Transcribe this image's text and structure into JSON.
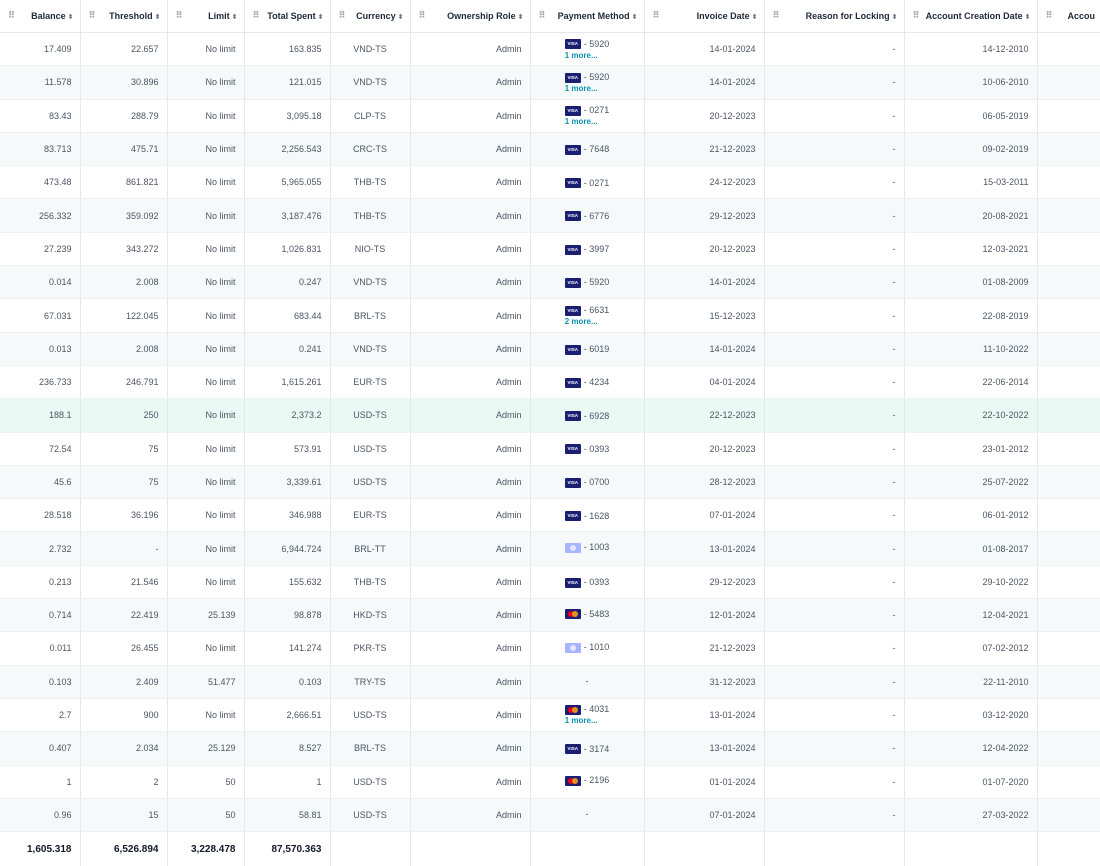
{
  "columns": [
    {
      "key": "balance",
      "label": "Balance"
    },
    {
      "key": "threshold",
      "label": "Threshold"
    },
    {
      "key": "limit",
      "label": "Limit"
    },
    {
      "key": "total_spent",
      "label": "Total Spent"
    },
    {
      "key": "currency",
      "label": "Currency"
    },
    {
      "key": "ownership_role",
      "label": "Ownership Role"
    },
    {
      "key": "payment_method",
      "label": "Payment Method"
    },
    {
      "key": "invoice_date",
      "label": "Invoice Date"
    },
    {
      "key": "reason_locking",
      "label": "Reason for Locking"
    },
    {
      "key": "account_creation_date",
      "label": "Account Creation Date"
    },
    {
      "key": "account_more",
      "label": "Accou"
    }
  ],
  "icons": {
    "drag_handle": "drag-handle-icon",
    "sort": "sort-icon"
  },
  "rows": [
    {
      "balance": "17.409",
      "threshold": "22.657",
      "limit": "No limit",
      "total_spent": "163.835",
      "currency": "VND-TS",
      "role": "Admin",
      "card": "visa",
      "last4": "- 5920",
      "more": "1 more...",
      "invoice": "14-01-2024",
      "reason": "-",
      "created": "14-12-2010"
    },
    {
      "balance": "11.578",
      "threshold": "30.896",
      "limit": "No limit",
      "total_spent": "121.015",
      "currency": "VND-TS",
      "role": "Admin",
      "card": "visa",
      "last4": "- 5920",
      "more": "1 more...",
      "invoice": "14-01-2024",
      "reason": "-",
      "created": "10-06-2010"
    },
    {
      "balance": "83.43",
      "threshold": "288.79",
      "limit": "No limit",
      "total_spent": "3,095.18",
      "currency": "CLP-TS",
      "role": "Admin",
      "card": "visa",
      "last4": "- 0271",
      "more": "1 more...",
      "invoice": "20-12-2023",
      "reason": "-",
      "created": "06-05-2019"
    },
    {
      "balance": "83.713",
      "threshold": "475.71",
      "limit": "No limit",
      "total_spent": "2,256.543",
      "currency": "CRC-TS",
      "role": "Admin",
      "card": "visa",
      "last4": "- 7648",
      "more": "",
      "invoice": "21-12-2023",
      "reason": "-",
      "created": "09-02-2019"
    },
    {
      "balance": "473.48",
      "threshold": "861.821",
      "limit": "No limit",
      "total_spent": "5,965.055",
      "currency": "THB-TS",
      "role": "Admin",
      "card": "visa",
      "last4": "- 0271",
      "more": "",
      "invoice": "24-12-2023",
      "reason": "-",
      "created": "15-03-2011"
    },
    {
      "balance": "256.332",
      "threshold": "359.092",
      "limit": "No limit",
      "total_spent": "3,187.476",
      "currency": "THB-TS",
      "role": "Admin",
      "card": "visa",
      "last4": "- 6776",
      "more": "",
      "invoice": "29-12-2023",
      "reason": "-",
      "created": "20-08-2021"
    },
    {
      "balance": "27.239",
      "threshold": "343.272",
      "limit": "No limit",
      "total_spent": "1,026.831",
      "currency": "NIO-TS",
      "role": "Admin",
      "card": "visa",
      "last4": "- 3997",
      "more": "",
      "invoice": "20-12-2023",
      "reason": "-",
      "created": "12-03-2021"
    },
    {
      "balance": "0.014",
      "threshold": "2.008",
      "limit": "No limit",
      "total_spent": "0.247",
      "currency": "VND-TS",
      "role": "Admin",
      "card": "visa",
      "last4": "- 5920",
      "more": "",
      "invoice": "14-01-2024",
      "reason": "-",
      "created": "01-08-2009"
    },
    {
      "balance": "67.031",
      "threshold": "122.045",
      "limit": "No limit",
      "total_spent": "683.44",
      "currency": "BRL-TS",
      "role": "Admin",
      "card": "visa",
      "last4": "- 6631",
      "more": "2 more...",
      "invoice": "15-12-2023",
      "reason": "-",
      "created": "22-08-2019"
    },
    {
      "balance": "0.013",
      "threshold": "2.008",
      "limit": "No limit",
      "total_spent": "0.241",
      "currency": "VND-TS",
      "role": "Admin",
      "card": "visa",
      "last4": "- 6019",
      "more": "",
      "invoice": "14-01-2024",
      "reason": "-",
      "created": "11-10-2022"
    },
    {
      "balance": "236.733",
      "threshold": "246.791",
      "limit": "No limit",
      "total_spent": "1,615.261",
      "currency": "EUR-TS",
      "role": "Admin",
      "card": "visa",
      "last4": "- 4234",
      "more": "",
      "invoice": "04-01-2024",
      "reason": "-",
      "created": "22-06-2014"
    },
    {
      "balance": "188.1",
      "threshold": "250",
      "limit": "No limit",
      "total_spent": "2,373.2",
      "currency": "USD-TS",
      "role": "Admin",
      "card": "visa",
      "last4": "- 6928",
      "more": "",
      "invoice": "22-12-2023",
      "reason": "-",
      "created": "22-10-2022",
      "highlight": true
    },
    {
      "balance": "72.54",
      "threshold": "75",
      "limit": "No limit",
      "total_spent": "573.91",
      "currency": "USD-TS",
      "role": "Admin",
      "card": "visa",
      "last4": "- 0393",
      "more": "",
      "invoice": "20-12-2023",
      "reason": "-",
      "created": "23-01-2012"
    },
    {
      "balance": "45.6",
      "threshold": "75",
      "limit": "No limit",
      "total_spent": "3,339.61",
      "currency": "USD-TS",
      "role": "Admin",
      "card": "visa",
      "last4": "- 0700",
      "more": "",
      "invoice": "28-12-2023",
      "reason": "-",
      "created": "25-07-2022"
    },
    {
      "balance": "28.518",
      "threshold": "36.196",
      "limit": "No limit",
      "total_spent": "346.988",
      "currency": "EUR-TS",
      "role": "Admin",
      "card": "visa",
      "last4": "- 1628",
      "more": "",
      "invoice": "07-01-2024",
      "reason": "-",
      "created": "06-01-2012"
    },
    {
      "balance": "2.732",
      "threshold": "-",
      "limit": "No limit",
      "total_spent": "6,944.724",
      "currency": "BRL-TT",
      "role": "Admin",
      "card": "other",
      "last4": "- 1003",
      "more": "",
      "invoice": "13-01-2024",
      "reason": "-",
      "created": "01-08-2017"
    },
    {
      "balance": "0.213",
      "threshold": "21.546",
      "limit": "No limit",
      "total_spent": "155.632",
      "currency": "THB-TS",
      "role": "Admin",
      "card": "visa",
      "last4": "- 0393",
      "more": "",
      "invoice": "29-12-2023",
      "reason": "-",
      "created": "29-10-2022"
    },
    {
      "balance": "0.714",
      "threshold": "22.419",
      "limit": "25.139",
      "total_spent": "98.878",
      "currency": "HKD-TS",
      "role": "Admin",
      "card": "mc",
      "last4": "- 5483",
      "more": "",
      "invoice": "12-01-2024",
      "reason": "-",
      "created": "12-04-2021"
    },
    {
      "balance": "0.011",
      "threshold": "26.455",
      "limit": "No limit",
      "total_spent": "141.274",
      "currency": "PKR-TS",
      "role": "Admin",
      "card": "other",
      "last4": "- 1010",
      "more": "",
      "invoice": "21-12-2023",
      "reason": "-",
      "created": "07-02-2012"
    },
    {
      "balance": "0.103",
      "threshold": "2.409",
      "limit": "51.477",
      "total_spent": "0.103",
      "currency": "TRY-TS",
      "role": "Admin",
      "card": "",
      "last4": "-",
      "more": "",
      "invoice": "31-12-2023",
      "reason": "-",
      "created": "22-11-2010"
    },
    {
      "balance": "2.7",
      "threshold": "900",
      "limit": "No limit",
      "total_spent": "2,666.51",
      "currency": "USD-TS",
      "role": "Admin",
      "card": "mc",
      "last4": "- 4031",
      "more": "1 more...",
      "invoice": "13-01-2024",
      "reason": "-",
      "created": "03-12-2020"
    },
    {
      "balance": "0.407",
      "threshold": "2.034",
      "limit": "25.129",
      "total_spent": "8.527",
      "currency": "BRL-TS",
      "role": "Admin",
      "card": "visa",
      "last4": "- 3174",
      "more": "",
      "invoice": "13-01-2024",
      "reason": "-",
      "created": "12-04-2022"
    },
    {
      "balance": "1",
      "threshold": "2",
      "limit": "50",
      "total_spent": "1",
      "currency": "USD-TS",
      "role": "Admin",
      "card": "mc",
      "last4": "- 2196",
      "more": "",
      "invoice": "01-01-2024",
      "reason": "-",
      "created": "01-07-2020"
    },
    {
      "balance": "0.96",
      "threshold": "15",
      "limit": "50",
      "total_spent": "58.81",
      "currency": "USD-TS",
      "role": "Admin",
      "card": "",
      "last4": "-",
      "more": "",
      "invoice": "07-01-2024",
      "reason": "-",
      "created": "27-03-2022"
    }
  ],
  "totals": {
    "balance": "1,605.318",
    "threshold": "6,526.894",
    "limit": "3,228.478",
    "total_spent": "87,570.363"
  },
  "card_labels": {
    "visa": "VISA"
  },
  "colors": {
    "visa": "#1a1f71",
    "more_link": "#0891b2",
    "highlight_row": "#e8faf3",
    "stripe_row": "#f5f9f9"
  }
}
